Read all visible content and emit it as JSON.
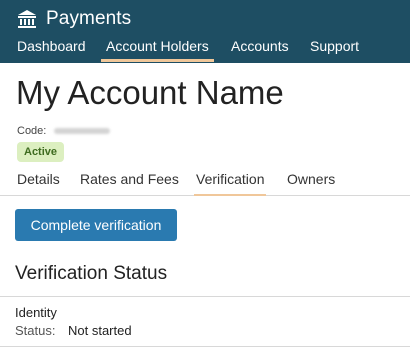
{
  "app": {
    "title": "Payments",
    "icon": "bank-icon"
  },
  "nav": {
    "items": [
      {
        "label": "Dashboard",
        "active": false
      },
      {
        "label": "Account Holders",
        "active": true
      },
      {
        "label": "Accounts",
        "active": false
      },
      {
        "label": "Support",
        "active": false
      }
    ]
  },
  "account": {
    "name": "My Account Name",
    "code_label": "Code:",
    "status_badge": "Active"
  },
  "tabs": [
    {
      "label": "Details",
      "active": false
    },
    {
      "label": "Rates and Fees",
      "active": false
    },
    {
      "label": "Verification",
      "active": true
    },
    {
      "label": "Owners",
      "active": false
    }
  ],
  "verification": {
    "button_label": "Complete verification",
    "section_title": "Verification Status",
    "items": [
      {
        "title": "Identity",
        "status_label": "Status:",
        "status_value": "Not started"
      }
    ]
  },
  "colors": {
    "topbar": "#1e4e63",
    "active_underline": "#f0c79a",
    "primary_button": "#2a7ab0",
    "badge_bg": "#dcefc0",
    "badge_text": "#3e6b1f"
  }
}
